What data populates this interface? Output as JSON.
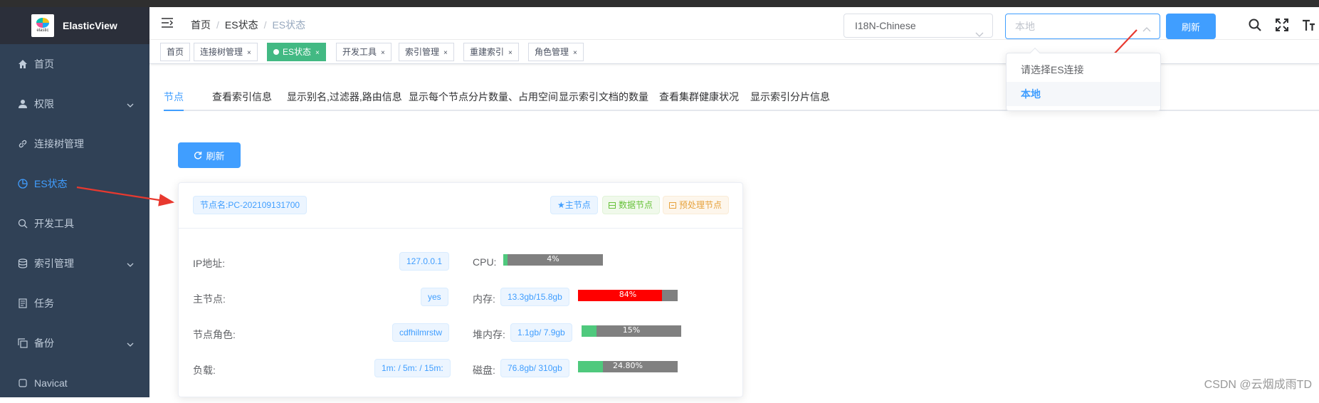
{
  "app": {
    "title": "ElasticView",
    "logo_caption": "elastic"
  },
  "sidebar": {
    "items": [
      {
        "label": "首页",
        "icon": "home-icon",
        "active": false
      },
      {
        "label": "权限",
        "icon": "user-icon",
        "active": false,
        "expandable": true
      },
      {
        "label": "连接树管理",
        "icon": "link-icon",
        "active": false
      },
      {
        "label": "ES状态",
        "icon": "pie-chart-icon",
        "active": true
      },
      {
        "label": "开发工具",
        "icon": "search-icon",
        "active": false
      },
      {
        "label": "索引管理",
        "icon": "database-icon",
        "active": false,
        "expandable": true
      },
      {
        "label": "任务",
        "icon": "document-icon",
        "active": false
      },
      {
        "label": "备份",
        "icon": "copy-icon",
        "active": false,
        "expandable": true
      },
      {
        "label": "Navicat",
        "icon": "navicat-icon",
        "active": false
      }
    ]
  },
  "breadcrumb": [
    "首页",
    "ES状态",
    "ES状态"
  ],
  "navbar": {
    "language": "I18N-Chinese",
    "connection_placeholder": "本地",
    "refresh_label": "刷新",
    "dropdown_options": [
      {
        "label": "请选择ES连接",
        "selected": false
      },
      {
        "label": "本地",
        "selected": true
      }
    ]
  },
  "tags": [
    {
      "label": "首页",
      "closable": false,
      "active": false
    },
    {
      "label": "连接树管理",
      "closable": true,
      "active": false
    },
    {
      "label": "ES状态",
      "closable": true,
      "active": true
    },
    {
      "label": "开发工具",
      "closable": true,
      "active": false
    },
    {
      "label": "索引管理",
      "closable": true,
      "active": false
    },
    {
      "label": "重建索引",
      "closable": true,
      "active": false
    },
    {
      "label": "角色管理",
      "closable": true,
      "active": false
    }
  ],
  "content_tabs": [
    "节点",
    "查看索引信息",
    "显示别名,过滤器,路由信息",
    "显示每个节点分片数量、占用空间",
    "显示索引文档的数量",
    "查看集群健康状况",
    "显示索引分片信息"
  ],
  "content": {
    "refresh_label": "刷新",
    "node_name_tag": "节点名:PC-202109131700",
    "role_tags": [
      "★主节点",
      "数据节点",
      "预处理节点"
    ],
    "left_rows": [
      {
        "label": "IP地址:",
        "value": "127.0.0.1"
      },
      {
        "label": "主节点:",
        "value": "yes"
      },
      {
        "label": "节点角色:",
        "value": "cdfhilmrstw"
      },
      {
        "label": "负载:",
        "value": "1m: / 5m: / 15m:"
      }
    ],
    "right_rows": [
      {
        "label": "CPU:",
        "value": "",
        "percent_text": "4%",
        "percent": 4,
        "color": "#4fc97d"
      },
      {
        "label": "内存:",
        "value": "13.3gb/15.8gb",
        "percent_text": "84%",
        "percent": 84,
        "color": "#ff0000"
      },
      {
        "label": "堆内存:",
        "value": "1.1gb/ 7.9gb",
        "percent_text": "15%",
        "percent": 15,
        "color": "#4fc97d"
      },
      {
        "label": "磁盘:",
        "value": "76.8gb/ 310gb",
        "percent_text": "24.80%",
        "percent": 24.8,
        "color": "#4fc97d"
      }
    ]
  },
  "watermark": "CSDN @云烟成雨TD",
  "colors": {
    "primary": "#409eff",
    "sidebar": "#304156",
    "active_tag": "#42b983",
    "arrow": "#e8392f"
  }
}
